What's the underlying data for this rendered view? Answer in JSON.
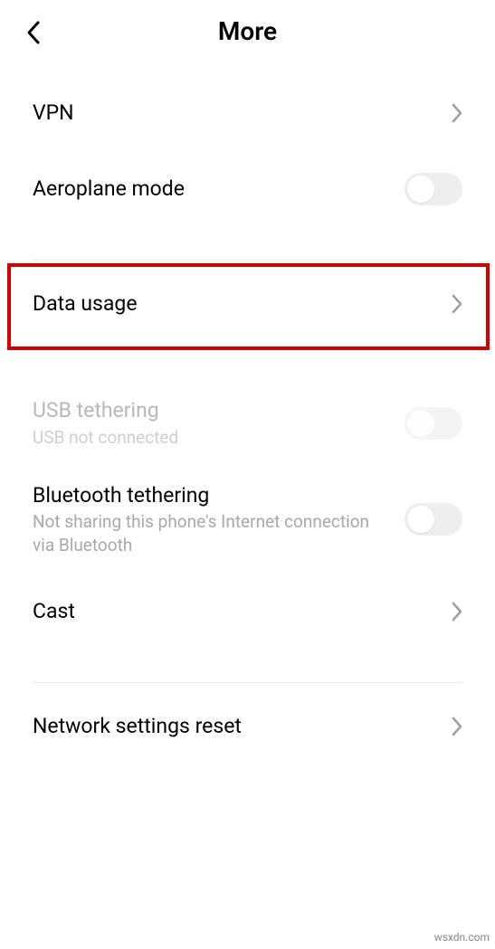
{
  "header": {
    "title": "More"
  },
  "items": {
    "vpn": {
      "label": "VPN"
    },
    "aeroplane": {
      "label": "Aeroplane mode"
    },
    "dataUsage": {
      "label": "Data usage"
    },
    "usbTether": {
      "label": "USB tethering",
      "sub": "USB not connected"
    },
    "btTether": {
      "label": "Bluetooth tethering",
      "sub": "Not sharing this phone's Internet connection via Bluetooth"
    },
    "cast": {
      "label": "Cast"
    },
    "netReset": {
      "label": "Network settings reset"
    }
  },
  "watermark": "wsxdn.com"
}
